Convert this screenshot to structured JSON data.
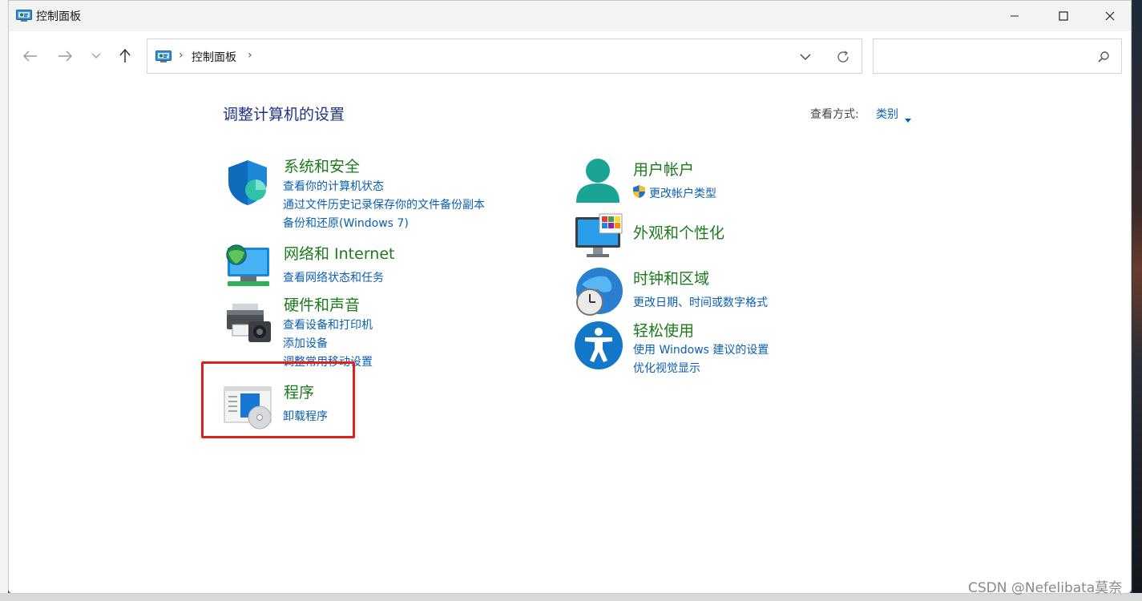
{
  "window": {
    "title": "控制面板"
  },
  "address": {
    "crumbs": [
      "控制面板"
    ],
    "search_placeholder": ""
  },
  "content": {
    "heading": "调整计算机的设置",
    "view_by_label": "查看方式:",
    "view_by_value": "类别"
  },
  "categories": {
    "system_security": {
      "title": "系统和安全",
      "links": [
        "查看你的计算机状态",
        "通过文件历史记录保存你的文件备份副本",
        "备份和还原(Windows 7)"
      ]
    },
    "network": {
      "title": "网络和 Internet",
      "links": [
        "查看网络状态和任务"
      ]
    },
    "hardware": {
      "title": "硬件和声音",
      "links": [
        "查看设备和打印机",
        "添加设备",
        "调整常用移动设置"
      ]
    },
    "programs": {
      "title": "程序",
      "links": [
        "卸载程序"
      ]
    },
    "user_accounts": {
      "title": "用户帐户",
      "links": [
        "更改帐户类型"
      ]
    },
    "appearance": {
      "title": "外观和个性化",
      "links": []
    },
    "clock_region": {
      "title": "时钟和区域",
      "links": [
        "更改日期、时间或数字格式"
      ]
    },
    "ease_of_access": {
      "title": "轻松使用",
      "links": [
        "使用 Windows 建议的设置",
        "优化视觉显示"
      ]
    }
  },
  "watermark": "CSDN @Nefelibata莫奈",
  "colors": {
    "category_title": "#1b7a1b",
    "link": "#0a5fb4",
    "heading": "#1e3287",
    "highlight": "#e0201b"
  }
}
